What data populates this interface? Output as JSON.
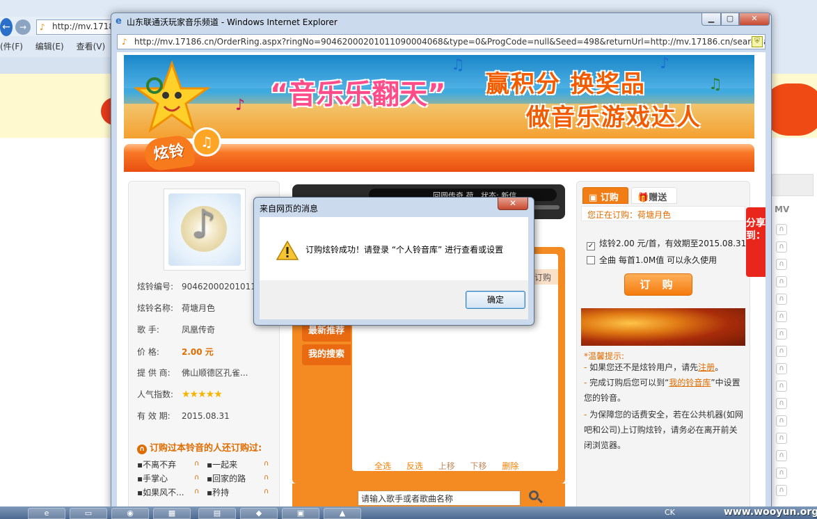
{
  "background_browser": {
    "url": "http://mv.17186",
    "menu": [
      "(件(F)",
      "编辑(E)",
      "查看(V)"
    ]
  },
  "popup": {
    "title": "山东联通沃玩家音乐频道 - Windows Internet Explorer",
    "url": "http://mv.17186.cn/OrderRing.aspx?ringNo=90462000201011090004068&type=0&ProgCode=null&Seed=498&returnUrl=http://mv.17186.cn/search.aspx",
    "controls": {
      "minimize": "▁",
      "maximize": "▢",
      "close": "✕"
    }
  },
  "banner": {
    "title": "“音乐乐翻天”",
    "line1": "赢积分 换奖品",
    "line2": "做音乐游戏达人"
  },
  "section": {
    "badge": "炫铃",
    "music_icon": "♫"
  },
  "ring_info": {
    "rows": [
      {
        "label": "炫铃编号:",
        "value": "9046200020101110..."
      },
      {
        "label": "炫铃名称:",
        "value": "荷塘月色"
      },
      {
        "label": "歌  手:",
        "value": "凤凰传奇"
      },
      {
        "label": "价  格:",
        "value": "2.00 元"
      },
      {
        "label": "提 供 商:",
        "value": "佛山顺德区孔雀..."
      },
      {
        "label": "人气指数:",
        "value": "★★★★★"
      },
      {
        "label": "有 效 期:",
        "value": "2015.08.31"
      }
    ],
    "popularity_stars": 5,
    "also_title": "订购过本铃音的人还订购过:",
    "also_items": [
      "不离不弃",
      "一起来",
      "手掌心",
      "回家的路",
      "如果风不...",
      "矜持"
    ]
  },
  "player": {
    "display": "回圆传奇  荷 . 状态: 新信",
    "list_header": "订购",
    "tabs": [
      "最新推荐",
      "我的搜索"
    ],
    "actions": [
      "全选",
      "反选",
      "上移",
      "下移",
      "删除"
    ],
    "search_placeholder": "请输入歌手或者歌曲名称"
  },
  "order": {
    "tab_order": "订购",
    "tab_gift": "赠送",
    "ordering_now": "您正在订购：荷塘月色",
    "option1": "炫铃2.00 元/首，有效期至2015.08.31",
    "option1_checked": true,
    "option2": "全曲  每首1.0M值  可以永久使用",
    "option2_checked": false,
    "button": "订 购",
    "tips_title": "*温馨提示:",
    "tip1_pre": "如果您还不是炫铃用户，请先",
    "tip1_link": "注册",
    "tip1_post": "。",
    "tip2_pre": "完成订购后您可以到“",
    "tip2_link": "我的铃音库",
    "tip2_post": "”中设置您的铃音。",
    "tip3": "为保障您的话费安全，若在公共机器(如网吧和公司)上订购炫铃，请务必在离开前关闭浏览器。"
  },
  "share": "分享到：",
  "dialog": {
    "title": "来自网页的消息",
    "message": "订购炫铃成功！请登录 “个人铃音库” 进行查看或设置",
    "ok": "确定",
    "close": "✕"
  },
  "right_bg": {
    "mv": "MV"
  },
  "watermark": "www.wooyun.org",
  "tray": "CK"
}
